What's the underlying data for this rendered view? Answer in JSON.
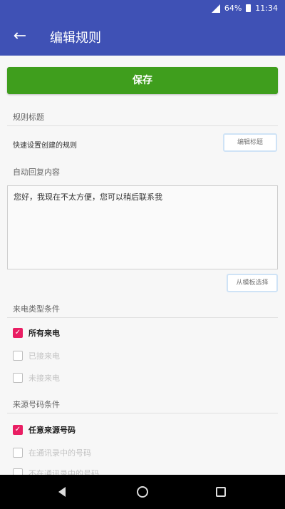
{
  "status_bar": {
    "battery": "64%",
    "time": "11:34"
  },
  "app_bar": {
    "title": "编辑规则"
  },
  "save_button": "保存",
  "rule_title_section": {
    "label": "规则标题",
    "value": "快速设置创建的规则",
    "edit_button": "编辑标题"
  },
  "auto_reply_section": {
    "label": "自动回复内容",
    "text": "您好，我现在不太方便，您可以稍后联系我",
    "template_button": "从模板选择"
  },
  "call_type_section": {
    "label": "来电类型条件",
    "options": [
      {
        "label": "所有来电",
        "checked": true
      },
      {
        "label": "已接来电",
        "checked": false
      },
      {
        "label": "未接来电",
        "checked": false
      }
    ]
  },
  "source_number_section": {
    "label": "来源号码条件",
    "options": [
      {
        "label": "任意来源号码",
        "checked": true
      },
      {
        "label": "在通讯录中的号码",
        "checked": false
      },
      {
        "label": "不在通讯录中的号码",
        "checked": false
      }
    ]
  },
  "colors": {
    "primary": "#3f51b5",
    "save": "#3f9e1d",
    "checkbox": "#e91e63"
  }
}
